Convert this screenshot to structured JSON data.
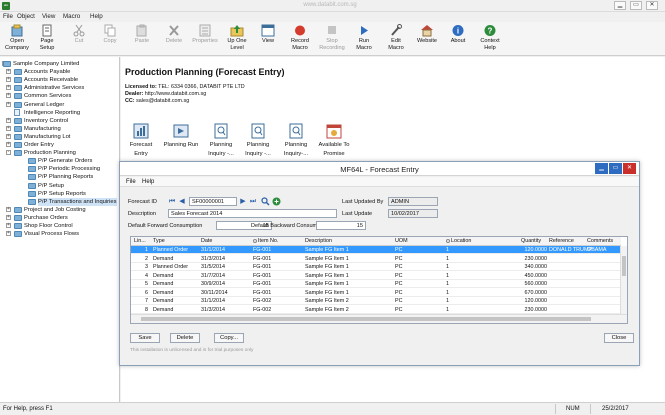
{
  "app": {
    "icon_text": "ʷᵒ",
    "title": "www.databit.com.sg"
  },
  "window_buttons": {
    "minimize": "▁",
    "restore": "▭",
    "close": "✕"
  },
  "menu": [
    "File",
    "Object",
    "View",
    "Macro",
    "Help"
  ],
  "toolbar": [
    {
      "label1": "Open",
      "label2": "Company",
      "icon": "open-company-icon",
      "enabled": true
    },
    {
      "label1": "Page",
      "label2": "Setup",
      "icon": "page-setup-icon",
      "enabled": true
    },
    {
      "label1": "Cut",
      "label2": "",
      "icon": "cut-icon",
      "enabled": false
    },
    {
      "label1": "Copy",
      "label2": "",
      "icon": "copy-icon",
      "enabled": false
    },
    {
      "label1": "Paste",
      "label2": "",
      "icon": "paste-icon",
      "enabled": false
    },
    {
      "label1": "Delete",
      "label2": "",
      "icon": "delete-icon",
      "enabled": false
    },
    {
      "label1": "Properties",
      "label2": "",
      "icon": "properties-icon",
      "enabled": false
    },
    {
      "label1": "Up One",
      "label2": "Level",
      "icon": "up-one-level-icon",
      "enabled": true
    },
    {
      "label1": "View",
      "label2": "",
      "icon": "view-icon",
      "enabled": true
    },
    {
      "label1": "Record",
      "label2": "Macro",
      "icon": "record-macro-icon",
      "enabled": true
    },
    {
      "label1": "Stop",
      "label2": "Recording",
      "icon": "stop-recording-icon",
      "enabled": false
    },
    {
      "label1": "Run",
      "label2": "Macro",
      "icon": "run-macro-icon",
      "enabled": true
    },
    {
      "label1": "Edit",
      "label2": "Macro",
      "icon": "edit-macro-icon",
      "enabled": true
    },
    {
      "label1": "Website",
      "label2": "",
      "icon": "website-icon",
      "enabled": true
    },
    {
      "label1": "About",
      "label2": "",
      "icon": "about-icon",
      "enabled": true
    },
    {
      "label1": "Context",
      "label2": "Help",
      "icon": "context-help-icon",
      "enabled": true
    }
  ],
  "tree": [
    {
      "label": "Sample Company Limited",
      "level": 0,
      "kind": "root",
      "exp": "-"
    },
    {
      "label": "Accounts Payable",
      "level": 1,
      "kind": "folder",
      "exp": "+"
    },
    {
      "label": "Accounts Receivable",
      "level": 1,
      "kind": "folder",
      "exp": "+"
    },
    {
      "label": "Administrative Services",
      "level": 1,
      "kind": "folder",
      "exp": "+"
    },
    {
      "label": "Common Services",
      "level": 1,
      "kind": "folder",
      "exp": "+"
    },
    {
      "label": "General Ledger",
      "level": 1,
      "kind": "folder",
      "exp": "+"
    },
    {
      "label": "Intelligence Reporting",
      "level": 1,
      "kind": "doc",
      "exp": ""
    },
    {
      "label": "Inventory Control",
      "level": 1,
      "kind": "folder",
      "exp": "+"
    },
    {
      "label": "Manufacturing",
      "level": 1,
      "kind": "folder",
      "exp": "+"
    },
    {
      "label": "Manufacturing Lot",
      "level": 1,
      "kind": "folder",
      "exp": "+"
    },
    {
      "label": "Order Entry",
      "level": 1,
      "kind": "folder",
      "exp": "+"
    },
    {
      "label": "Production Planning",
      "level": 1,
      "kind": "folder",
      "exp": "-"
    },
    {
      "label": "P/P Generate Orders",
      "level": 2,
      "kind": "folder",
      "exp": ""
    },
    {
      "label": "P/P Periodic Processing",
      "level": 2,
      "kind": "folder",
      "exp": ""
    },
    {
      "label": "P/P Planning Reports",
      "level": 2,
      "kind": "folder",
      "exp": ""
    },
    {
      "label": "P/P Setup",
      "level": 2,
      "kind": "folder",
      "exp": ""
    },
    {
      "label": "P/P Setup Reports",
      "level": 2,
      "kind": "folder",
      "exp": ""
    },
    {
      "label": "P/P Transactions and Inquiries",
      "level": 2,
      "kind": "folder",
      "exp": "",
      "selected": true
    },
    {
      "label": "Project and Job Costing",
      "level": 1,
      "kind": "folder",
      "exp": "+"
    },
    {
      "label": "Purchase Orders",
      "level": 1,
      "kind": "folder",
      "exp": "+"
    },
    {
      "label": "Shop Floor Control",
      "level": 1,
      "kind": "folder",
      "exp": "+"
    },
    {
      "label": "Visual Process Flows",
      "level": 1,
      "kind": "folder",
      "exp": "+"
    }
  ],
  "main": {
    "title": "Production Planning (Forecast Entry)",
    "license_label": "Licensed to:",
    "license_value": "TEL: 6334 0366, DATABIT PTE LTD",
    "dealer_label": "Dealer:",
    "dealer_value": "http://www.databit.com.sg",
    "cc_label": "CC:",
    "cc_value": "sales@databit.com.sg",
    "modules": [
      {
        "label1": "Forecast",
        "label2": "Entry",
        "icon": "forecast-entry-icon"
      },
      {
        "label1": "Planning Run",
        "label2": "",
        "icon": "planning-run-icon"
      },
      {
        "label1": "Planning",
        "label2": "Inquiry -...",
        "icon": "planning-inquiry-icon"
      },
      {
        "label1": "Planning",
        "label2": "Inquiry -...",
        "icon": "planning-inquiry-icon"
      },
      {
        "label1": "Planning",
        "label2": "Inquiry-...",
        "icon": "planning-inquiry-icon"
      },
      {
        "label1": "Available To",
        "label2": "Promise",
        "icon": "available-to-promise-icon"
      }
    ]
  },
  "dialog": {
    "title": "MF64L - Forecast Entry",
    "menu": [
      "File",
      "Help"
    ],
    "forecast_id_label": "Forecast ID",
    "forecast_id": "SF00000001",
    "description_label": "Description",
    "description": "Sales Forecast 2014",
    "fwd_label": "Default Forward Consumption",
    "fwd_value": "15",
    "bwd_label": "Default Backward Consumption",
    "bwd_value": "15",
    "last_updated_by_label": "Last Updated By",
    "last_updated_by": "ADMIN",
    "last_update_label": "Last Update",
    "last_update": "10/02/2017",
    "columns": [
      "Lin...",
      "Type",
      "Date",
      "Item No.",
      "Description",
      "UOM",
      "Location",
      "Quantity",
      "Reference",
      "Comments"
    ],
    "rows": [
      {
        "line": "1",
        "type": "Planned Order",
        "date": "31/1/2014",
        "item": "FG-001",
        "desc": "Sample FG Item 1",
        "uom": "PC",
        "loc": "1",
        "qty": "120.0000",
        "ref": "DONALD TRUMP",
        "comments": "OBAMA",
        "selected": true
      },
      {
        "line": "2",
        "type": "Demand",
        "date": "31/3/2014",
        "item": "FG-001",
        "desc": "Sample FG Item 1",
        "uom": "PC",
        "loc": "1",
        "qty": "230.0000",
        "ref": "",
        "comments": ""
      },
      {
        "line": "3",
        "type": "Planned Order",
        "date": "31/5/2014",
        "item": "FG-001",
        "desc": "Sample FG Item 1",
        "uom": "PC",
        "loc": "1",
        "qty": "340.0000",
        "ref": "",
        "comments": ""
      },
      {
        "line": "4",
        "type": "Demand",
        "date": "31/7/2014",
        "item": "FG-001",
        "desc": "Sample FG Item 1",
        "uom": "PC",
        "loc": "1",
        "qty": "450.0000",
        "ref": "",
        "comments": ""
      },
      {
        "line": "5",
        "type": "Demand",
        "date": "30/9/2014",
        "item": "FG-001",
        "desc": "Sample FG Item 1",
        "uom": "PC",
        "loc": "1",
        "qty": "560.0000",
        "ref": "",
        "comments": ""
      },
      {
        "line": "6",
        "type": "Demand",
        "date": "30/11/2014",
        "item": "FG-001",
        "desc": "Sample FG Item 1",
        "uom": "PC",
        "loc": "1",
        "qty": "670.0000",
        "ref": "",
        "comments": ""
      },
      {
        "line": "7",
        "type": "Demand",
        "date": "31/1/2014",
        "item": "FG-002",
        "desc": "Sample FG Item 2",
        "uom": "PC",
        "loc": "1",
        "qty": "120.0000",
        "ref": "",
        "comments": ""
      },
      {
        "line": "8",
        "type": "Demand",
        "date": "31/3/2014",
        "item": "FG-002",
        "desc": "Sample FG Item 2",
        "uom": "PC",
        "loc": "1",
        "qty": "230.0000",
        "ref": "",
        "comments": ""
      }
    ],
    "save_label": "Save",
    "delete_label": "Delete",
    "copy_label": "Copy...",
    "close_label": "Close",
    "eval_note": "This installation is unlicensed and is for trial purposes only"
  },
  "status": {
    "help": "For Help, press F1",
    "mode": "NUM",
    "date": "25/2/2017"
  },
  "colors": {
    "selection": "#3399ff",
    "dialog_close": "#c9302c",
    "dialog_btn": "#2d6cc0"
  }
}
